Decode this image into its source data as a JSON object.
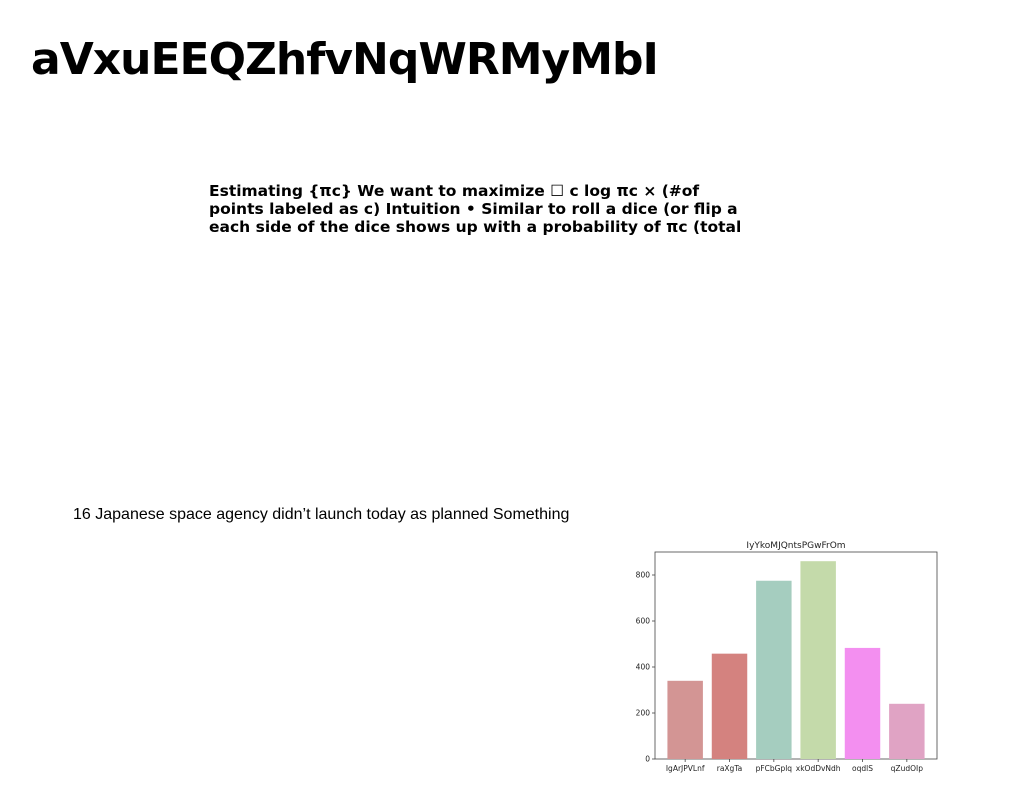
{
  "page": {
    "title": "aVxuEEQZhfvNqWRMyMbI"
  },
  "text_block": {
    "lines": [
      "Estimating {πc} We want to maximize ☐ c log πc × (#of",
      "points labeled as c) Intuition • Similar to roll a dice (or flip a",
      "each side of the dice shows up with a probability of πc (total"
    ]
  },
  "caption": {
    "text": "16 Japanese space agency didn’t launch today as planned Something"
  },
  "chart_data": {
    "type": "bar",
    "title": "IyYkoMJQntsPGwFrOm",
    "xlabel": "",
    "ylabel": "",
    "categories": [
      "IgArJPVLnf",
      "raXgTa",
      "pFCbGplq",
      "xkOdDvNdh",
      "oqdlS",
      "qZudOIp"
    ],
    "values": [
      340,
      458,
      775,
      860,
      483,
      240
    ],
    "colors": [
      "#d39594",
      "#d4827f",
      "#a5cdbf",
      "#c4daaa",
      "#f38ff0",
      "#e0a3c4"
    ],
    "ylim": [
      0,
      900
    ],
    "yticks": [
      0,
      200,
      400,
      600,
      800
    ],
    "grid": false
  }
}
